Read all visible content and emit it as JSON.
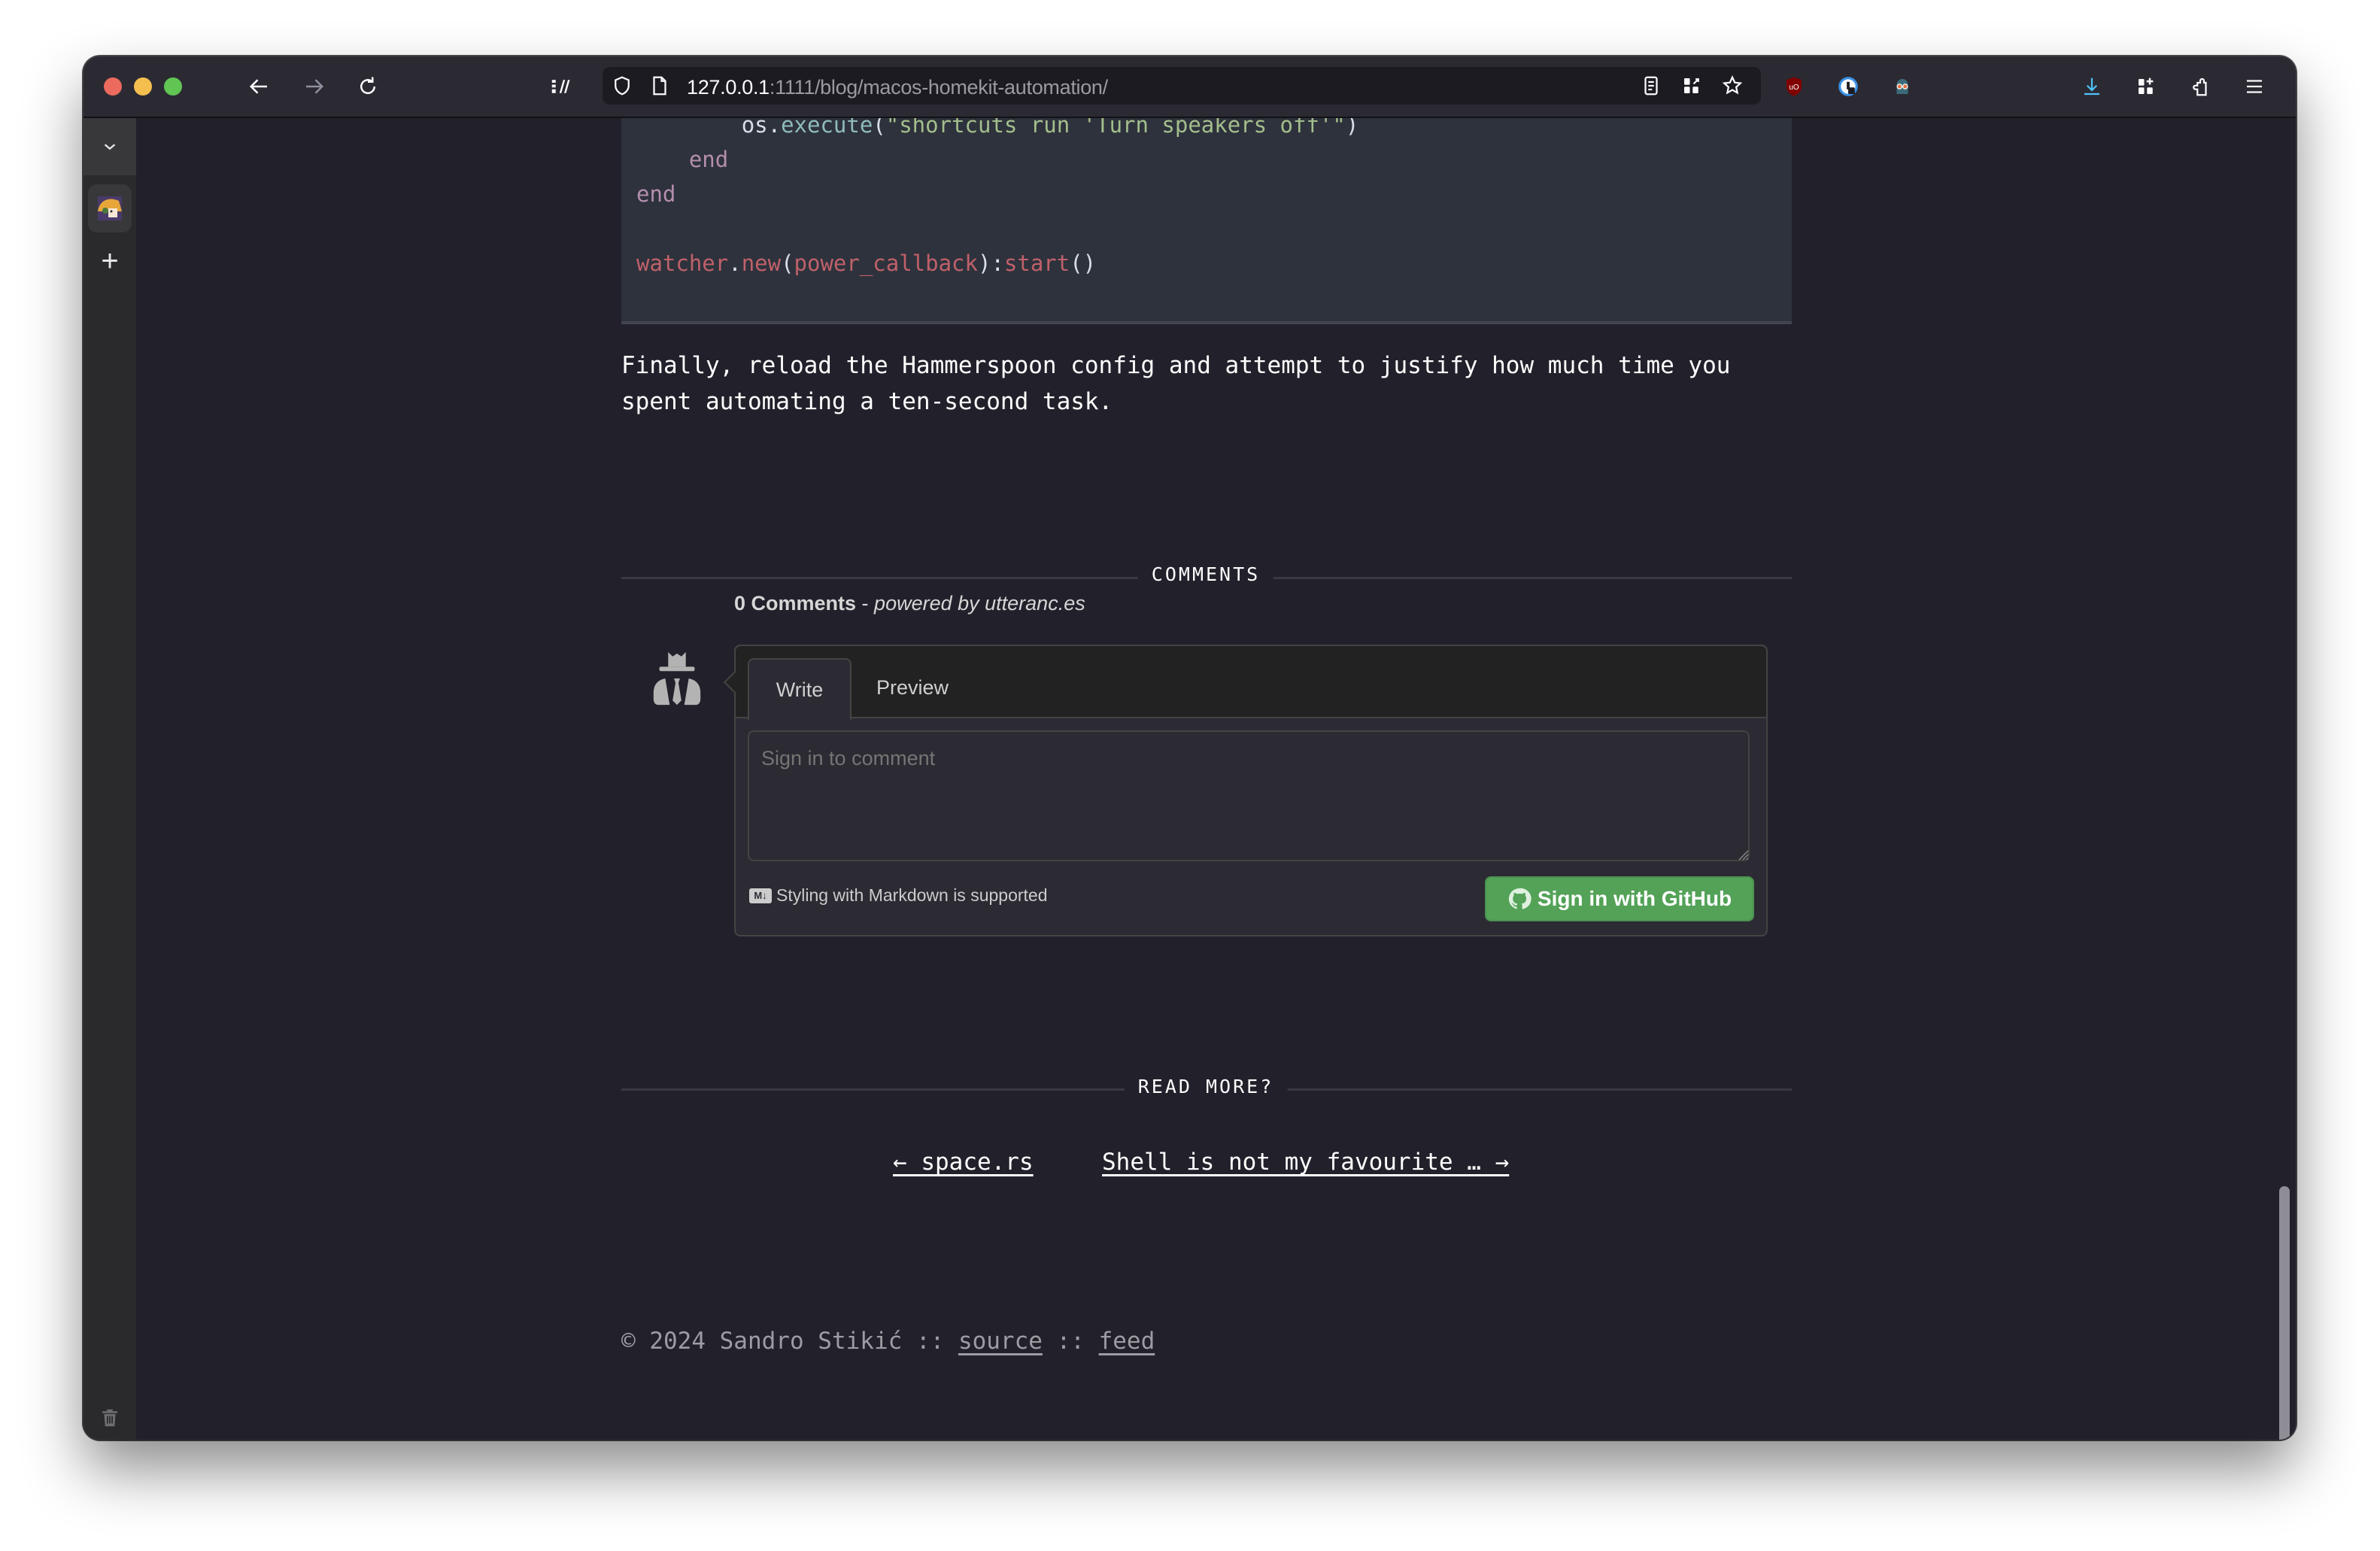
{
  "browser": {
    "url_host": "127.0.0.1",
    "url_rest": ":1111/blog/macos-homekit-automation/",
    "toolbar_icons": [
      "back-icon",
      "forward-icon",
      "reload-icon",
      "sidebar-toggle-icon",
      "shield-icon",
      "page-icon",
      "reader-view-icon",
      "qr-code-icon",
      "bookmark-star-icon",
      "ublock-icon",
      "password-manager-icon",
      "privacy-extension-icon",
      "downloads-icon",
      "extensions-grid-icon",
      "extensions-puzzle-icon",
      "menu-icon"
    ],
    "sidebar": {
      "collapse_icon": "chevron-down-icon",
      "add_label": "+",
      "trash_icon": "trash-icon"
    }
  },
  "code": {
    "lines": [
      {
        "indent": "        ",
        "tokens": [
          {
            "t": "os.",
            "c": "plain"
          },
          {
            "t": "execute",
            "c": "fn"
          },
          {
            "t": "(",
            "c": "plain"
          },
          {
            "t": "\"shortcuts run 'Turn speakers off'\"",
            "c": "str"
          },
          {
            "t": ")",
            "c": "plain"
          }
        ]
      },
      {
        "indent": "    ",
        "tokens": [
          {
            "t": "end",
            "c": "kw"
          }
        ]
      },
      {
        "indent": "",
        "tokens": [
          {
            "t": "end",
            "c": "kw"
          }
        ]
      },
      {
        "indent": "",
        "tokens": []
      },
      {
        "indent": "",
        "tokens": [
          {
            "t": "watcher",
            "c": "red"
          },
          {
            "t": ".",
            "c": "plain"
          },
          {
            "t": "new",
            "c": "red"
          },
          {
            "t": "(",
            "c": "plain"
          },
          {
            "t": "power_callback",
            "c": "red"
          },
          {
            "t": "):",
            "c": "plain"
          },
          {
            "t": "start",
            "c": "red"
          },
          {
            "t": "()",
            "c": "plain"
          }
        ]
      }
    ]
  },
  "article": {
    "final_paragraph": "Finally, reload the Hammerspoon config and attempt to justify how much time you spent automating a ten-second task."
  },
  "comments": {
    "section_title": "COMMENTS",
    "count_label": "0 Comments",
    "separator": " - ",
    "powered_by": "powered by utteranc.es",
    "tabs": [
      "Write",
      "Preview"
    ],
    "active_tab": "Write",
    "textarea_placeholder": "Sign in to comment",
    "markdown_note": "Styling with Markdown is supported",
    "markdown_badge": "M↓",
    "signin_button": "Sign in with GitHub",
    "button_color": "#53a257"
  },
  "read_more": {
    "title": "READ MORE?",
    "prev": "← space.rs",
    "next": "Shell is not my favourite … →"
  },
  "footer": {
    "copyright": "© 2024 Sandro Stikić",
    "sep1": " :: ",
    "source": "source",
    "sep2": " :: ",
    "feed": "feed"
  }
}
